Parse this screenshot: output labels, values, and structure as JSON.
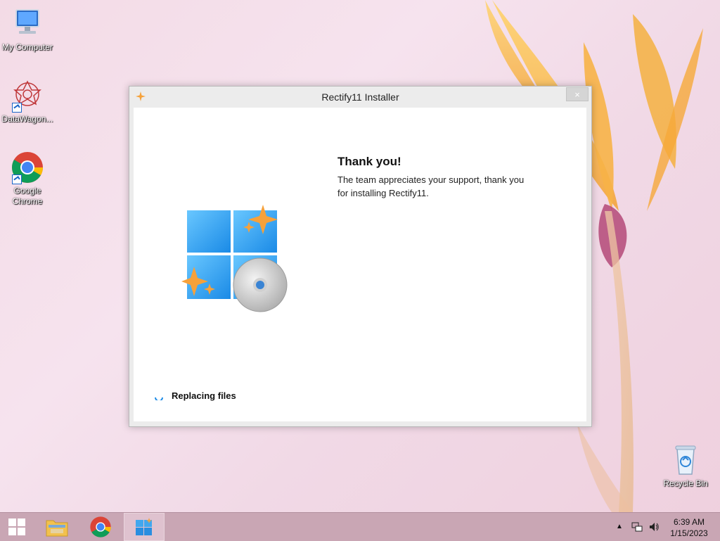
{
  "desktop": {
    "icons": [
      {
        "label": "My Computer",
        "icon": "computer-icon"
      },
      {
        "label": "DataWagon...",
        "icon": "datawagon-icon"
      },
      {
        "label": "Google Chrome",
        "icon": "chrome-icon"
      },
      {
        "label": "Recycle Bin",
        "icon": "recycle-bin-icon"
      }
    ]
  },
  "window": {
    "title": "Rectify11 Installer",
    "close_glyph": "×",
    "heading": "Thank you!",
    "description": "The team appreciates your support, thank you for installing Rectify11.",
    "status": "Replacing files"
  },
  "taskbar": {
    "items": [
      {
        "name": "start-button",
        "icon": "windows-logo-icon"
      },
      {
        "name": "file-explorer",
        "icon": "folder-icon"
      },
      {
        "name": "google-chrome",
        "icon": "chrome-icon"
      },
      {
        "name": "rectify11-installer",
        "icon": "rectify11-icon",
        "active": true
      }
    ],
    "tray": {
      "chevron": "▲",
      "time": "6:39 AM",
      "date": "1/15/2023"
    }
  },
  "colors": {
    "accent_blue": "#1a8ae6",
    "sparkle_orange": "#f6a13a",
    "taskbar": "#c9a6b4"
  }
}
